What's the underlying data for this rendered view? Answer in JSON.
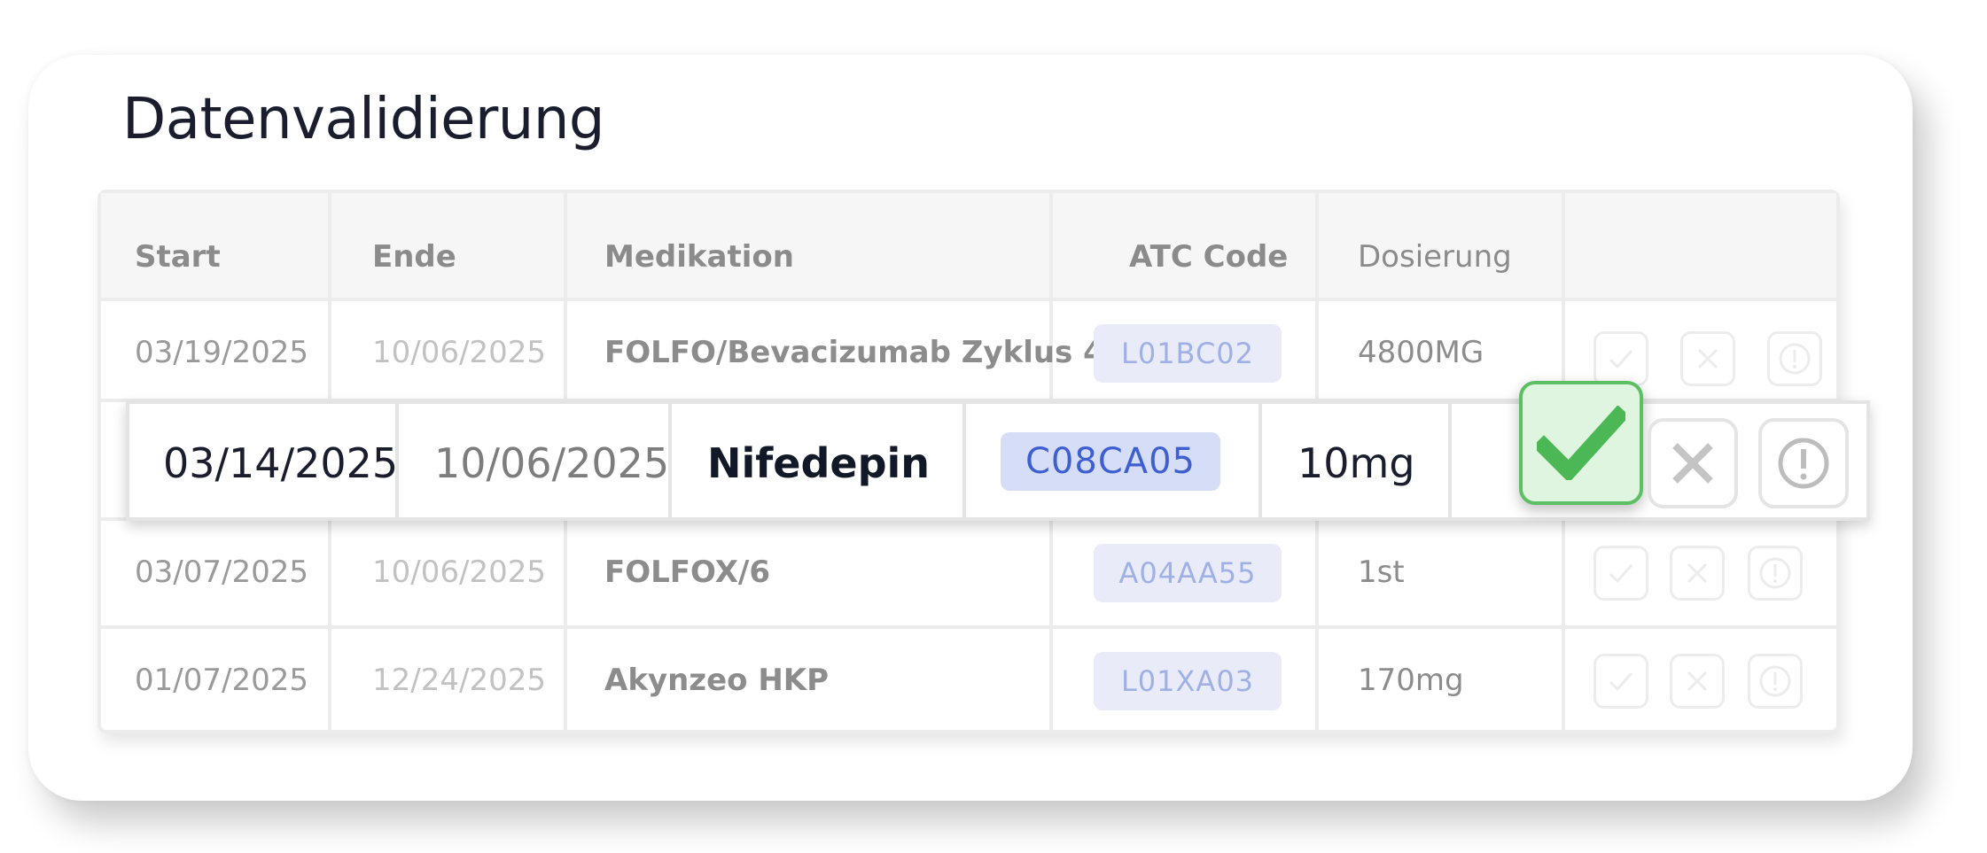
{
  "title": "Datenvalidierung",
  "table": {
    "headers": {
      "start": "Start",
      "end": "Ende",
      "medication": "Medikation",
      "atc": "ATC Code",
      "dosage": "Dosierung"
    },
    "rows": [
      {
        "start": "03/19/2025",
        "end": "10/06/2025",
        "medication": "FOLFO/Bevacizumab Zyklus 4",
        "atc": "L01BC02",
        "dosage": "4800MG"
      },
      {
        "start": "03/07/2025",
        "end": "10/06/2025",
        "medication": "FOLFOX/6",
        "atc": "A04AA55",
        "dosage": "1st"
      },
      {
        "start": "01/07/2025",
        "end": "12/24/2025",
        "medication": "Akynzeo HKP",
        "atc": "L01XA03",
        "dosage": "170mg"
      }
    ]
  },
  "highlighted_row": {
    "start": "03/14/2025",
    "end": "10/06/2025",
    "medication": "Nifedepin",
    "atc": "C08CA05",
    "dosage": "10mg"
  },
  "actions": {
    "accept_icon": "checkmark-icon",
    "reject_icon": "close-icon",
    "flag_icon": "exclamation-circle-icon"
  },
  "colors": {
    "accept_green": "#4cb755",
    "accept_bg": "#dff5df",
    "badge_text": "#3d5fd0",
    "badge_bg": "#d6ddf6"
  }
}
